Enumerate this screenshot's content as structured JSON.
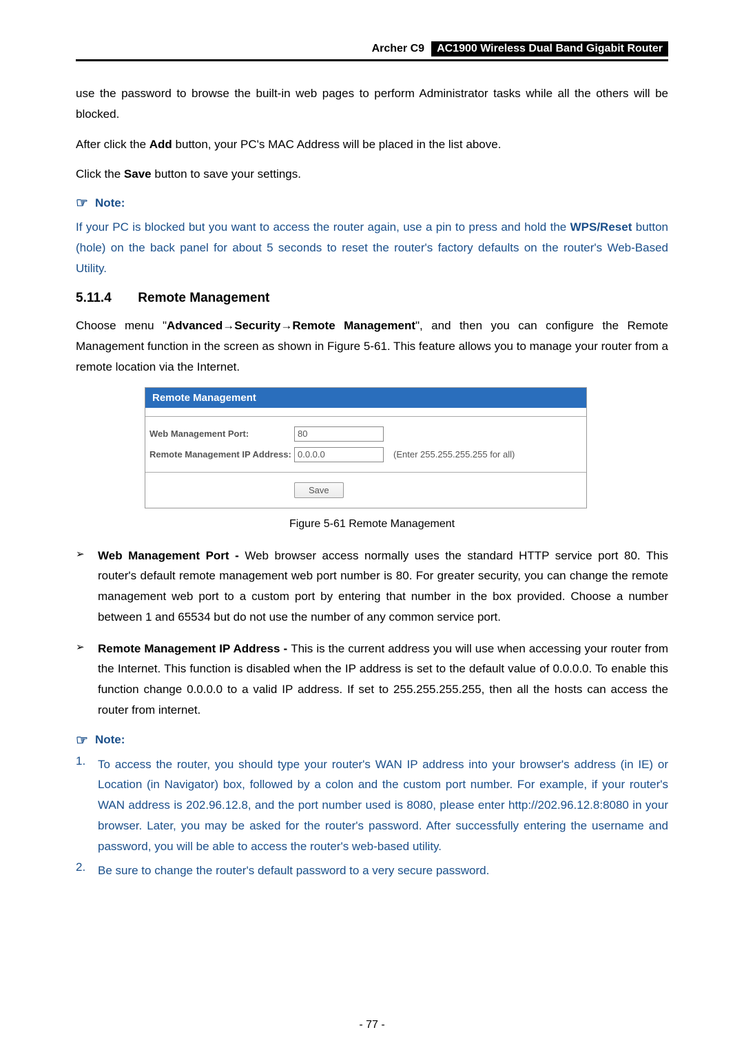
{
  "header": {
    "model": "Archer C9",
    "title": "AC1900 Wireless Dual Band Gigabit Router"
  },
  "para1": "use the password to browse the built-in web pages to perform Administrator tasks while all the others will be blocked.",
  "para2_pre": "After click the ",
  "para2_bold": "Add",
  "para2_post": " button, your PC's MAC Address will be placed in the list above.",
  "para3_pre": "Click the ",
  "para3_bold": "Save",
  "para3_post": " button to save your settings.",
  "note1": {
    "label": "Note:",
    "body_pre": "If your PC is blocked but you want to access the router again, use a pin to press and hold the ",
    "body_bold": "WPS/Reset",
    "body_post": " button (hole) on the back panel for about 5 seconds to reset the router's factory defaults on the router's Web-Based Utility."
  },
  "section": {
    "num": "5.11.4",
    "title": "Remote Management"
  },
  "navpara_pre": "Choose menu \"",
  "navpara_b1": "Advanced",
  "navpara_arrow": "→",
  "navpara_b2": "Security",
  "navpara_b3": "Remote Management",
  "navpara_post": "\", and then you can configure the Remote Management function in the screen as shown in Figure 5-61. This feature allows you to manage your router from a remote location via the Internet.",
  "panel": {
    "title": "Remote Management",
    "row1_label": "Web Management Port:",
    "row1_value": "80",
    "row2_label": "Remote Management IP Address:",
    "row2_value": "0.0.0.0",
    "row2_hint": "(Enter 255.255.255.255 for all)",
    "save": "Save"
  },
  "figure_caption": "Figure 5-61 Remote Management",
  "bullets": [
    {
      "title": "Web Management Port - ",
      "body": "Web browser access normally uses the standard HTTP service port 80. This router's default remote management web port number is 80. For greater security, you can change the remote management web port to a custom port by entering that number in the box provided. Choose a number between 1 and 65534 but do not use the number of any common service port."
    },
    {
      "title": "Remote Management IP Address - ",
      "body": "This is the current address you will use when accessing your router from the Internet. This function is disabled when the IP address is set to the default value of 0.0.0.0. To enable this function change 0.0.0.0 to a valid IP address. If set to 255.255.255.255, then all the hosts can access the router from internet."
    }
  ],
  "note2_label": "Note:",
  "numlist": [
    "To access the router, you should type your router's WAN IP address into your browser's address (in IE) or Location (in Navigator) box, followed by a colon and the custom port number. For example, if your router's WAN address is 202.96.12.8, and the port number used is 8080, please enter http://202.96.12.8:8080 in your browser. Later, you may be asked for the router's password. After successfully entering the username and password, you will be able to access the router's web-based utility.",
    "Be sure to change the router's default password to a very secure password."
  ],
  "pagenum": "- 77 -"
}
